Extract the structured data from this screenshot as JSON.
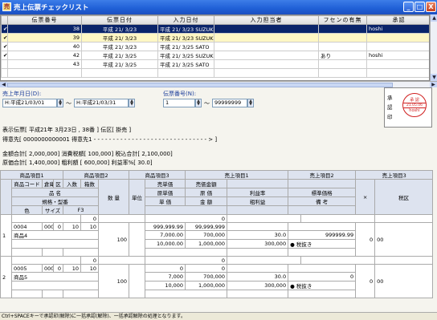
{
  "window": {
    "title": "売上伝票チェックリスト",
    "min": "_",
    "max": "□",
    "close": "X"
  },
  "grid": {
    "headers": [
      "伝票番号",
      "伝票日付",
      "入力日付",
      "入力担当者",
      "フセンの有無",
      "承認"
    ],
    "rows": [
      {
        "check": "✔",
        "no": "38",
        "date": "平成 21/ 3/23",
        "input": "平成 21/ 3/23 SUZUKI",
        "person": "",
        "fusen": "",
        "approve": "hoshi",
        "state": "cur"
      },
      {
        "check": "✔",
        "no": "39",
        "date": "平成 21/ 3/23",
        "input": "平成 21/ 3/23 SUZUKI",
        "person": "",
        "fusen": "",
        "approve": "",
        "state": "sel"
      },
      {
        "check": "✔",
        "no": "40",
        "date": "平成 21/ 3/23",
        "input": "平成 21/ 3/25 SATO",
        "person": "",
        "fusen": "",
        "approve": "",
        "state": ""
      },
      {
        "check": "✔",
        "no": "42",
        "date": "平成 21/ 3/25",
        "input": "平成 21/ 3/25 SUZUKI",
        "person": "",
        "fusen": "あり",
        "approve": "hoshi",
        "state": ""
      },
      {
        "check": "",
        "no": "43",
        "date": "平成 21/ 3/25",
        "input": "平成 21/ 3/25 SATO",
        "person": "",
        "fusen": "",
        "approve": "",
        "state": ""
      }
    ]
  },
  "filter": {
    "date_label": "売上年月日(D):",
    "date_from": "H:平成21/03/01",
    "date_to": "H:平成21/03/31",
    "tilde": "〜",
    "no_label": "伝票番号(N):",
    "no_from": "1",
    "no_to": "99999999"
  },
  "approval": {
    "v1": "承",
    "v2": "認",
    "v3": "印",
    "stamp_top": "承 認",
    "stamp_mid": "21.05.06",
    "stamp_bot": "hoshi"
  },
  "summary": {
    "line1": "表示伝票[ 平成21年 3月23日 ,        38番 ]  伝区[ 掛売 ]",
    "line2": "得意先[ 0000000000001  得意先1 - - - - - - - - - - - - - - - - - - - - - - - - - - - - - - > ]",
    "line3": "金額合計[      2,000,000]  消費税額[         100,000]  税込合計[       2,100,000]",
    "line4": "原価合計[      1,400,000]  粗利額 [         600,000]  利益率%[             30.0]"
  },
  "detail": {
    "hdr1": [
      "商品項目1",
      "商品項目2",
      "商品項目3",
      "売上項目1",
      "売上項目2",
      "売上項目3"
    ],
    "hdr2": [
      "商品コード",
      "倉庫",
      "区",
      "入数",
      "箱数",
      "数 量",
      "単位",
      "売単価",
      "売価金額",
      "",
      "",
      "×",
      "税区"
    ],
    "hdr3": [
      "品  名",
      "原単価",
      "原 価",
      "利益率",
      "標準価格"
    ],
    "hdr4": [
      "規格・型番",
      "単 価",
      "金 額",
      "粗利益",
      "備 考"
    ],
    "hdr5": [
      "色",
      "サイズ",
      "F3"
    ],
    "rows": [
      {
        "no": "1",
        "zero1": "0",
        "zero2": "0",
        "code": "0004",
        "wh": "0001",
        "ku": "0",
        "iri": "10",
        "hako": "10",
        "name": "商品4",
        "qty": "100",
        "v1": "999,999.99",
        "v2": "99,999,999",
        "c1": "7,000.00",
        "c2": "700,000",
        "p1": "10,000.00",
        "p2": "1,000,000",
        "rate": "30.0",
        "gp": "300,000",
        "std": "999999.99",
        "x": "0",
        "tax": "00",
        "taxn": "● 税抜き"
      },
      {
        "no": "2",
        "zero1": "0",
        "zero2": "0",
        "code": "0005",
        "wh": "0001",
        "ku": "0",
        "iri": "10",
        "hako": "10",
        "name": "商品5",
        "qty": "100",
        "v1": "0",
        "v2": "0",
        "c1": "7,000",
        "c2": "700,000",
        "p1": "10,000",
        "p2": "1,000,000",
        "rate": "30.0",
        "gp": "300,000",
        "std": "0",
        "x": "0",
        "tax": "00",
        "taxn": "● 税抜き"
      }
    ]
  },
  "status": "Ctrl+SPACEキーで承認印(解除)に一括承認(解除)、一括承認解除の処理となります。"
}
